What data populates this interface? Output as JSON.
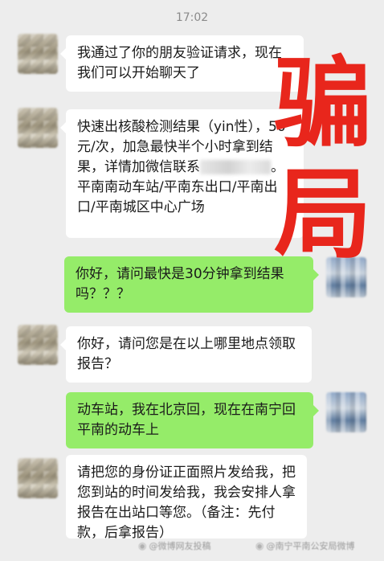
{
  "chat": {
    "timestamp": "17:02",
    "messages": [
      {
        "side": "left",
        "text": "我通过了你的朋友验证请求，现在我们可以开始聊天了"
      },
      {
        "side": "left",
        "text_a": "快速出核酸检测结果（yin性），50元/次，加急最快半个小时拿到结果，详情加微信联系",
        "text_b": "。平南南动车站/平南东出口/平南出口/平南城区中心广场"
      },
      {
        "side": "right",
        "text": "你好，请问最快是30分钟拿到结果吗？？？"
      },
      {
        "side": "left",
        "text": "你好，请问您是在以上哪里地点领取报告？"
      },
      {
        "side": "right",
        "text": "动车站，我在北京回，现在在南宁回平南的动车上"
      },
      {
        "side": "left",
        "text": "请把您的身份证正面照片发给我，把您到站的时间发给我，我会安排人拿报告在出站口等您。（备注：先付款，后拿报告）"
      }
    ]
  },
  "overlay": {
    "line1": "骗",
    "line2": "局",
    "color": "#e8261c"
  },
  "watermarks": {
    "left": "@微博网友投稿",
    "right": "@南宁平南公安局微博"
  },
  "colors": {
    "background": "#ededed",
    "bubble_white": "#ffffff",
    "bubble_green": "#95ec69"
  }
}
